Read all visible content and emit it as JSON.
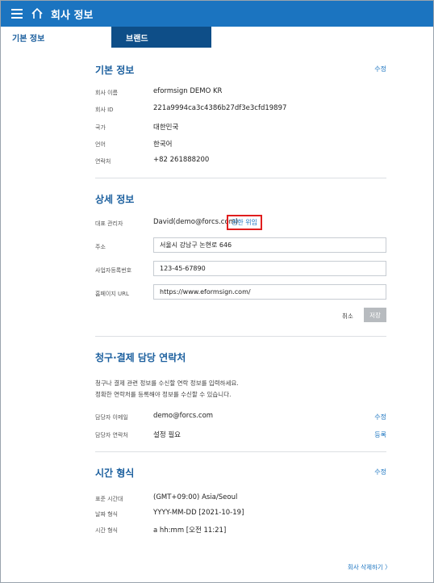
{
  "header": {
    "title": "회사 정보",
    "menu_icon": "hamburger-menu-icon",
    "home_icon": "home-icon"
  },
  "tabs": [
    {
      "label": "기본 정보",
      "active": true
    },
    {
      "label": "브랜드",
      "active": false
    }
  ],
  "basic": {
    "title": "기본 정보",
    "edit_label": "수정",
    "rows": [
      {
        "label": "회사 이름",
        "value": "eformsign DEMO KR"
      },
      {
        "label": "회사 ID",
        "value": "221a9994ca3c4386b27df3e3cfd19897"
      },
      {
        "label": "국가",
        "value": "대한민국"
      },
      {
        "label": "언어",
        "value": "한국어"
      },
      {
        "label": "연락처",
        "value": "+82 261888200"
      }
    ]
  },
  "detail": {
    "title": "상세 정보",
    "admin_label": "대표 관리자",
    "admin_value": "David(demo@forcs.com)",
    "delegate_label": "권한 위임",
    "address_label": "주소",
    "address_value": "서울시 강남구 논현로 646",
    "biz_label": "사업자등록번호",
    "biz_value": "123-45-67890",
    "homepage_label": "홈페이지 URL",
    "homepage_value": "https://www.eformsign.com/",
    "cancel_label": "취소",
    "save_label": "저장"
  },
  "billing": {
    "title": "청구·결제 담당 연락처",
    "desc_line1": "청구나 결제 관련 정보를 수신할 연락 정보를 입력하세요.",
    "desc_line2": "정확한 연락처를 등록해야 정보를 수신할 수 있습니다.",
    "email_label": "담당자 이메일",
    "email_value": "demo@forcs.com",
    "email_action": "수정",
    "phone_label": "담당자 연락처",
    "phone_value": "설정 필요",
    "phone_action": "등록"
  },
  "time": {
    "title": "시간 형식",
    "edit_label": "수정",
    "rows": [
      {
        "label": "표준 시간대",
        "value": "(GMT+09:00) Asia/Seoul"
      },
      {
        "label": "날짜 형식",
        "value": "YYYY-MM-DD [2021-10-19]"
      },
      {
        "label": "시간 형식",
        "value": "a hh:mm [오전 11:21]"
      }
    ]
  },
  "footer": {
    "delete_label": "회사 삭제하기 〉"
  },
  "colors": {
    "header": "#1b74c0",
    "brand_tab": "#0e4e88",
    "title": "#1b5f9e",
    "highlight": "#e01e1e"
  }
}
